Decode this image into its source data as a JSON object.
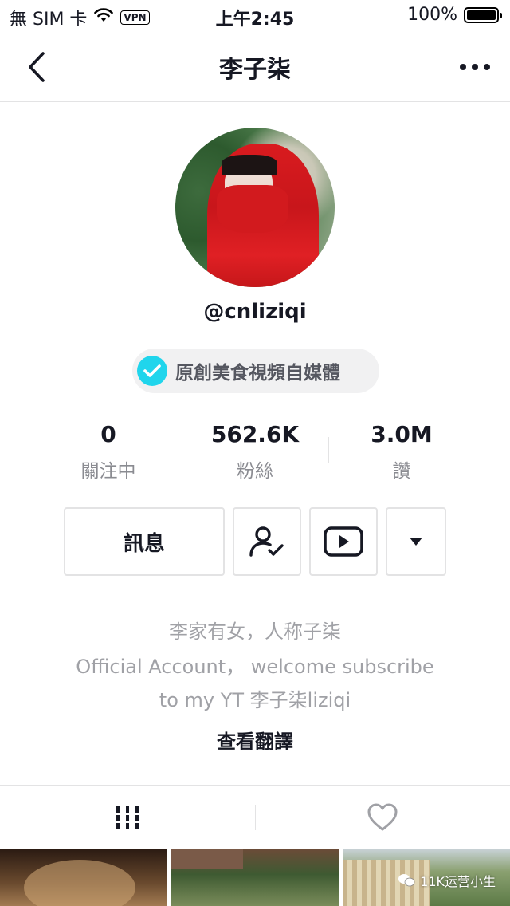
{
  "status_bar": {
    "carrier": "無 SIM 卡",
    "vpn": "VPN",
    "time": "上午2:45",
    "battery": "100%"
  },
  "nav": {
    "title": "李子柒"
  },
  "profile": {
    "handle": "@cnliziqi",
    "badge_text": "原創美食視頻自媒體"
  },
  "stats": [
    {
      "value": "0",
      "label": "關注中"
    },
    {
      "value": "562.6K",
      "label": "粉絲"
    },
    {
      "value": "3.0M",
      "label": "讚"
    }
  ],
  "actions": {
    "message_label": "訊息"
  },
  "bio": {
    "line1": "李家有女，人称子柒",
    "line2": "Official Account， welcome subscribe",
    "line3": "to my YT 李子柒liziqi",
    "translate_label": "查看翻譯"
  },
  "watermark": {
    "text": "11K运营小生"
  },
  "colors": {
    "verified": "#20d5ec",
    "text_primary": "#161823",
    "text_secondary": "#8a8b91",
    "divider": "#e3e3e4"
  }
}
